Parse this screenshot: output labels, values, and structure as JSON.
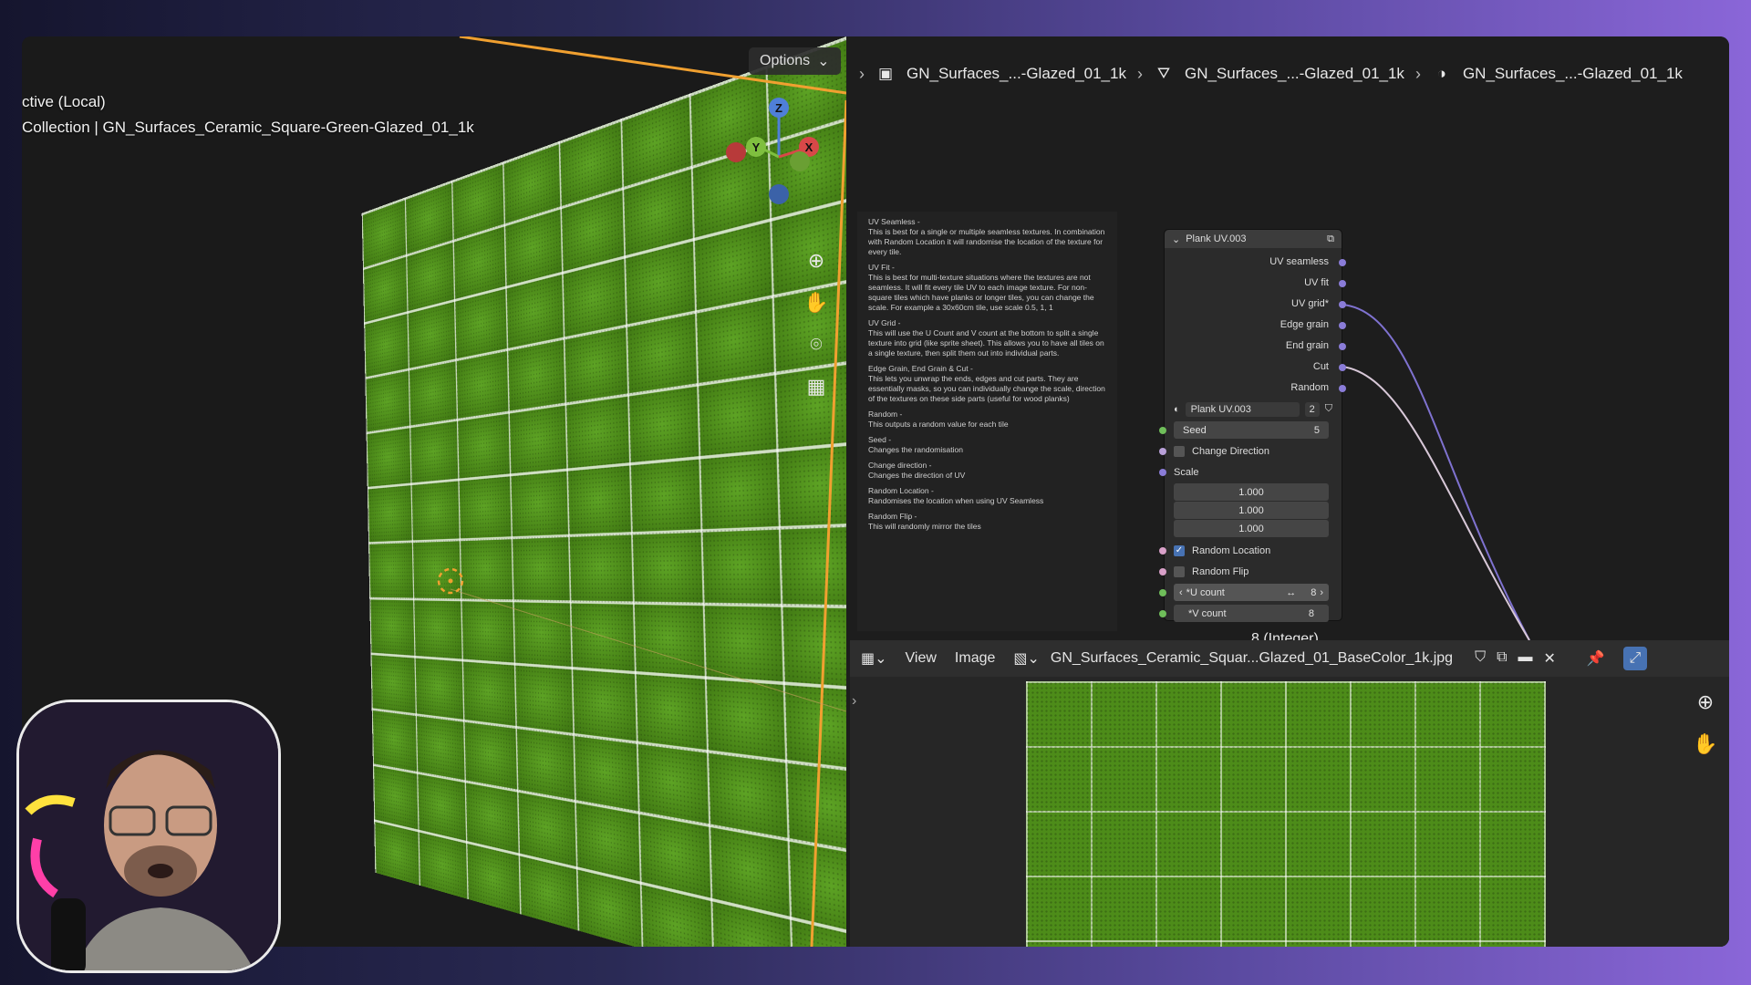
{
  "viewport": {
    "mode_label": "ctive (Local)",
    "collection_label": "Collection | GN_Surfaces_Ceramic_Square-Green-Glazed_01_1k",
    "options_label": "Options",
    "gizmo": {
      "z": "Z",
      "y": "Y",
      "x": "X"
    },
    "tools": [
      "zoom-icon",
      "pan-hand-icon",
      "camera-icon",
      "grid-icon"
    ]
  },
  "breadcrumb": {
    "items": [
      {
        "icon": "object-icon",
        "label": "GN_Surfaces_...-Glazed_01_1k"
      },
      {
        "icon": "mesh-icon",
        "label": "GN_Surfaces_...-Glazed_01_1k"
      },
      {
        "icon": "material-icon",
        "label": "GN_Surfaces_...-Glazed_01_1k"
      }
    ]
  },
  "note": {
    "sections": [
      {
        "title": "UV Seamless -",
        "body": "This is best for a single or multiple seamless textures. In combination with Random Location it will randomise the location of the texture for every tile."
      },
      {
        "title": "UV Fit -",
        "body": "This is best for multi-texture situations where the textures are not seamless. It will fit every tile UV to each image texture. For non-square tiles which have planks or longer tiles, you can change the scale. For example a 30x60cm tile, use scale 0.5, 1, 1"
      },
      {
        "title": "UV Grid -",
        "body": "This will use the U Count and V count at the bottom to split a single texture into grid (like sprite sheet). This allows you to have all tiles on a single texture, then split them out into individual parts."
      },
      {
        "title": "Edge Grain, End Grain & Cut -",
        "body": "This lets you unwrap the ends, edges and cut parts. They are essentially masks, so you can individually change the scale, direction of the textures on these side parts (useful for wood planks)"
      },
      {
        "title": "Random -",
        "body": "This outputs a random value for each tile"
      },
      {
        "title": "Seed -",
        "body": "Changes the randomisation"
      },
      {
        "title": "Change direction -",
        "body": "Changes the direction of UV"
      },
      {
        "title": "Random Location -",
        "body": "Randomises the location when using UV Seamless"
      },
      {
        "title": "Random Flip -",
        "body": "This will randomly mirror the tiles"
      }
    ]
  },
  "node": {
    "title": "Plank UV.003",
    "outputs": [
      "UV seamless",
      "UV fit",
      "UV grid*",
      "Edge grain",
      "End grain",
      "Cut",
      "Random"
    ],
    "datablock": {
      "name": "Plank UV.003",
      "users": "2"
    },
    "seed": {
      "label": "Seed",
      "value": "5"
    },
    "change_direction": {
      "label": "Change Direction",
      "checked": false
    },
    "scale": {
      "label": "Scale",
      "values": [
        "1.000",
        "1.000",
        "1.000"
      ]
    },
    "random_location": {
      "label": "Random Location",
      "checked": true
    },
    "random_flip": {
      "label": "Random Flip",
      "checked": false
    },
    "u_count": {
      "label": "*U count",
      "value": "8"
    },
    "v_count": {
      "label": "*V count",
      "value": "8"
    }
  },
  "tooltip": {
    "text": "8 (Integer)."
  },
  "image_editor": {
    "menu": {
      "view": "View",
      "image": "Image"
    },
    "filename": "GN_Surfaces_Ceramic_Squar...Glazed_01_BaseColor_1k.jpg"
  },
  "colors": {
    "tile_green": "#4f8e1a",
    "selection_orange": "#f0a030",
    "link_purple": "#8a7cd8",
    "socket_green": "#6fbe5a"
  }
}
